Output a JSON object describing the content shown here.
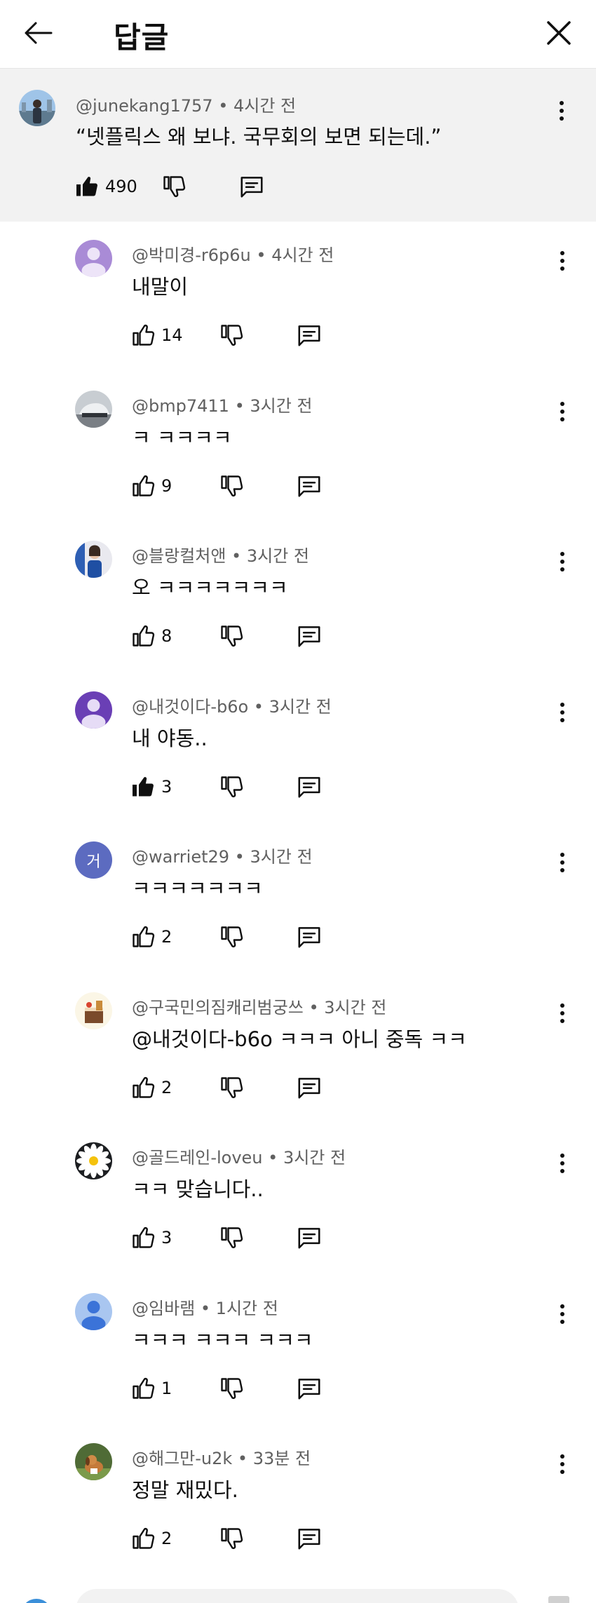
{
  "header": {
    "title": "답글"
  },
  "parent_comment": {
    "handle": "@junekang1757",
    "time": "4시간 전",
    "text": "“넷플릭스 왜 보냐. 국무회의 보면 되는데.”",
    "likes": "490",
    "liked": true
  },
  "replies": [
    {
      "handle": "@박미경-r6p6u",
      "time": "4시간 전",
      "text": "내말이",
      "likes": "14",
      "liked": false,
      "avatar": "purple-default"
    },
    {
      "handle": "@bmp7411",
      "time": "3시간 전",
      "text": "ㅋ ㅋㅋㅋㅋ",
      "likes": "9",
      "liked": false,
      "avatar": "car-photo"
    },
    {
      "handle": "@블랑컬처앤",
      "time": "3시간 전",
      "text": "오 ㅋㅋㅋㅋㅋㅋㅋ",
      "likes": "8",
      "liked": false,
      "avatar": "person-photo"
    },
    {
      "handle": "@내것이다-b6o",
      "time": "3시간 전",
      "text": "내 야동..",
      "likes": "3",
      "liked": true,
      "avatar": "purple-dark-default"
    },
    {
      "handle": "@warriet29",
      "time": "3시간 전",
      "text": "ㅋㅋㅋㅋㅋㅋㅋ",
      "likes": "2",
      "liked": false,
      "avatar": "letter",
      "avatar_letter": "거"
    },
    {
      "handle": "@구국민의짐캐리범궁쓰",
      "time": "3시간 전",
      "text": "@내것이다-b6o ㅋㅋㅋ 아니   중독 ㅋㅋ",
      "likes": "2",
      "liked": false,
      "avatar": "cake-photo"
    },
    {
      "handle": "@골드레인-loveu",
      "time": "3시간 전",
      "text": "ㅋㅋ 맞습니다..",
      "likes": "3",
      "liked": false,
      "avatar": "daisy-photo"
    },
    {
      "handle": "@임바램",
      "time": "1시간 전",
      "text": "ㅋㅋㅋ ㅋㅋㅋ ㅋㅋㅋ",
      "likes": "1",
      "liked": false,
      "avatar": "blue-default"
    },
    {
      "handle": "@해그만-u2k",
      "time": "33분 전",
      "text": "정말 재밌다.",
      "likes": "2",
      "liked": false,
      "avatar": "dog-photo"
    }
  ],
  "colors": {
    "meta": "#606060",
    "text": "#0f0f0f",
    "parent_bg": "#f2f2f2"
  },
  "icons": [
    "back-arrow-icon",
    "close-icon",
    "thumbs-up-icon",
    "thumbs-down-icon",
    "reply-icon",
    "more-vert-icon"
  ]
}
